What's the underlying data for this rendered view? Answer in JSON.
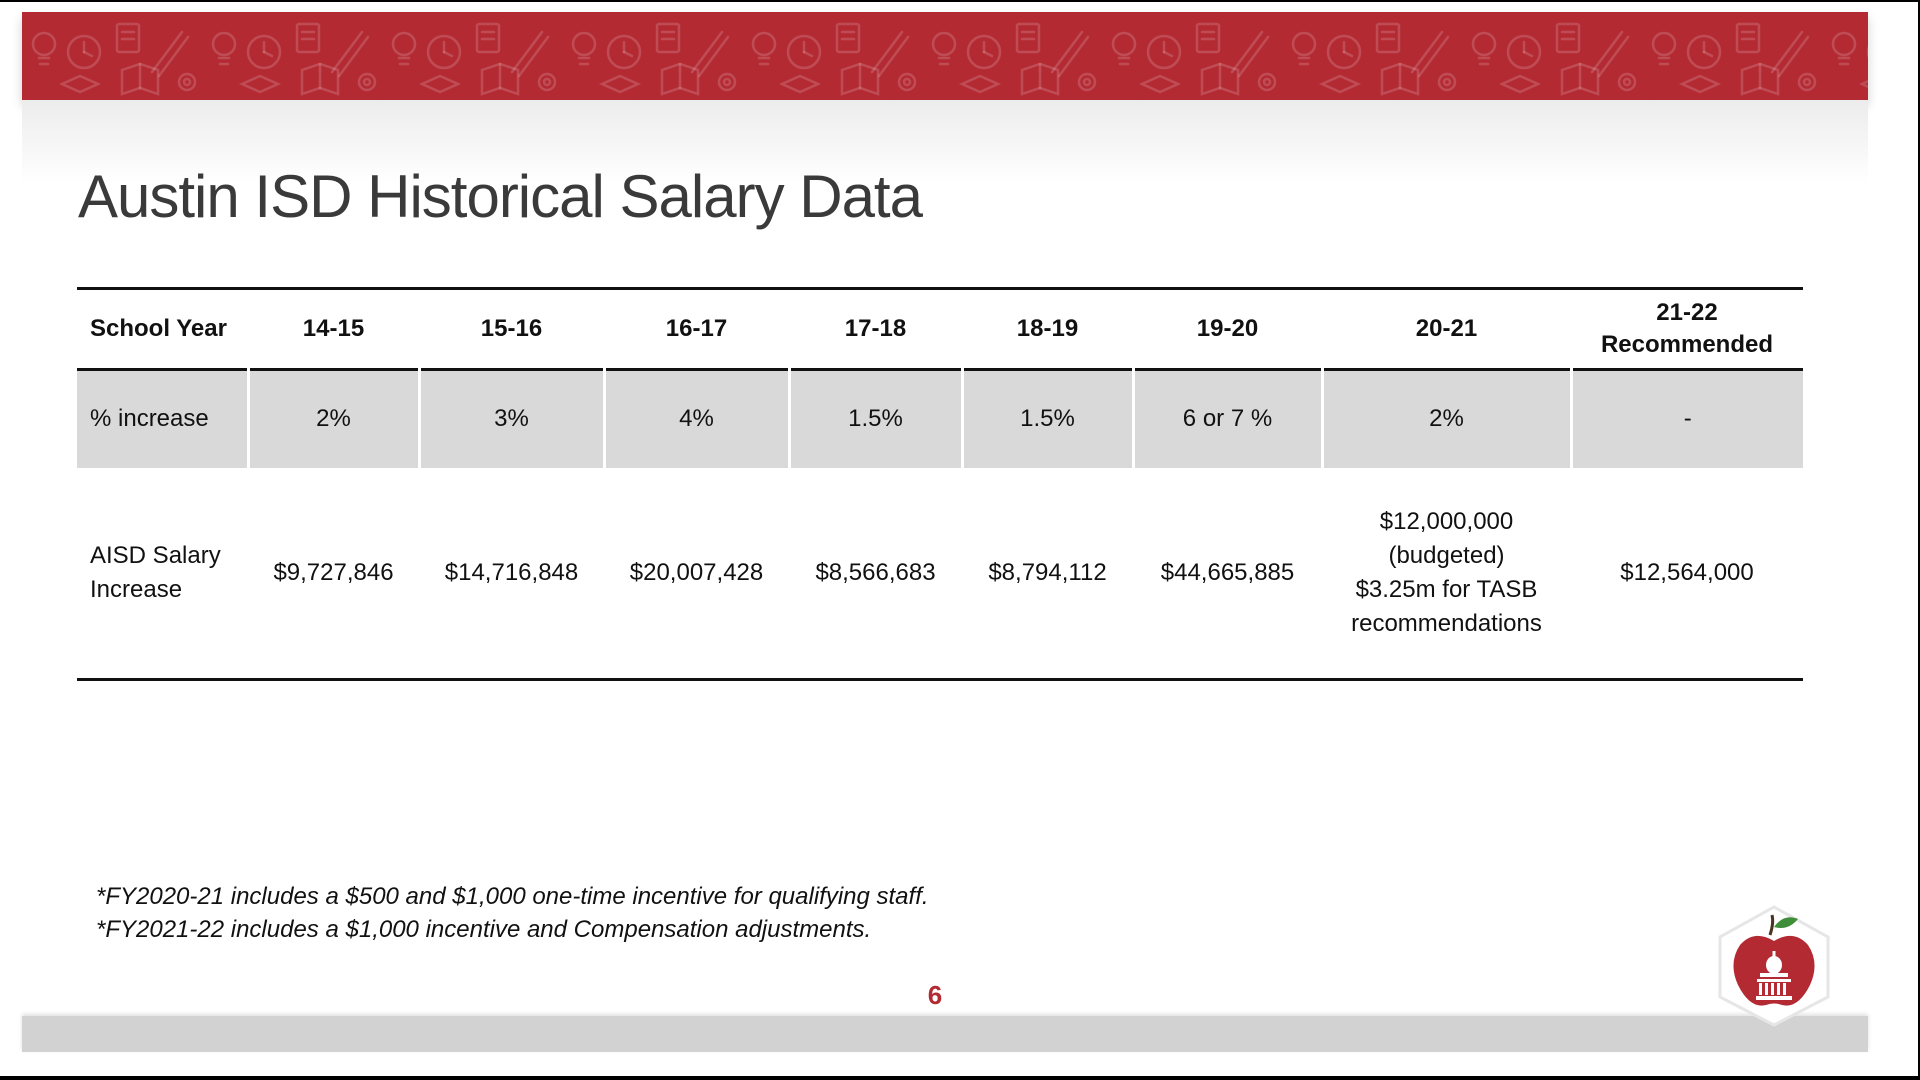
{
  "slide": {
    "title": "Austin ISD Historical Salary Data",
    "page_number": "6"
  },
  "table": {
    "headers": [
      "School Year",
      "14-15",
      "15-16",
      "16-17",
      "17-18",
      "18-19",
      "19-20",
      "20-21",
      "21-22",
      "Recommended"
    ],
    "percent_row": [
      "% increase",
      "2%",
      "3%",
      "4%",
      "1.5%",
      "1.5%",
      "6 or 7 %",
      "2%",
      "-"
    ],
    "amount_row": {
      "label_line1": "AISD Salary",
      "label_line2": "Increase",
      "values": [
        "$9,727,846",
        "$14,716,848",
        "$20,007,428",
        "$8,566,683",
        "$8,794,112",
        "$44,665,885"
      ],
      "year_20_21": [
        "$12,000,000",
        "(budgeted)",
        "$3.25m for TASB",
        "recommendations"
      ],
      "year_21_22": "$12,564,000"
    }
  },
  "footnotes": [
    "*FY2020-21 includes a $500 and $1,000 one-time incentive for qualifying staff.",
    "*FY2021-22 includes a $1,000 incentive and Compensation adjustments."
  ],
  "colors": {
    "banner": "#b32a33",
    "highlight_row": "#d9d9d9",
    "page_number": "#b32a33",
    "footer_bar": "#d2d2d2"
  },
  "icons": {
    "banner_pattern": [
      "lightbulb-icon",
      "clock-icon",
      "pencil-icon",
      "graduation-cap-icon",
      "book-icon",
      "document-icon",
      "gear-icon"
    ],
    "logo": "apple-capitol-logo-icon"
  }
}
